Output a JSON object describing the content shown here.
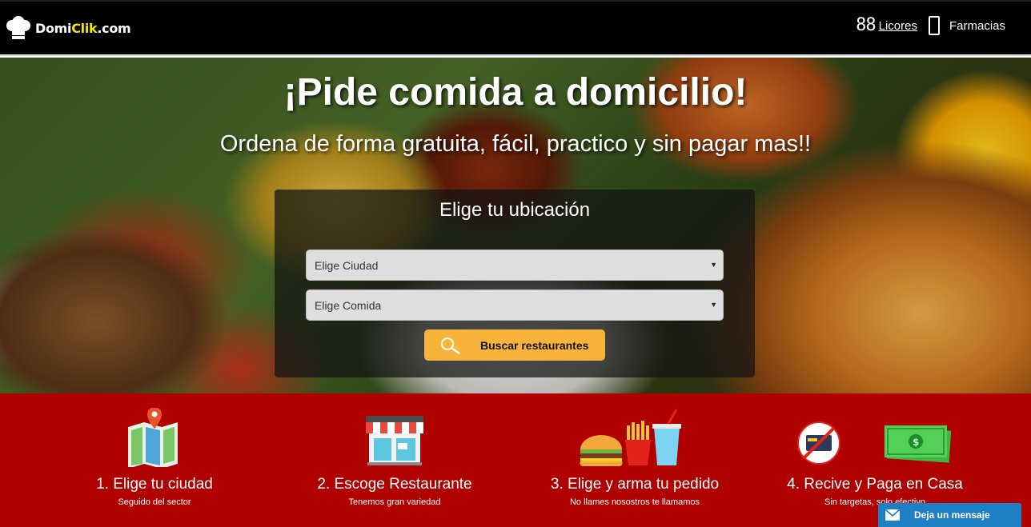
{
  "header": {
    "logo": {
      "text_main": "Domi",
      "text_highlight": "Clik",
      "text_suffix": ".com",
      "icon": "chef-hat-icon"
    },
    "nav": [
      {
        "icon": "88",
        "label": "Licores"
      },
      {
        "icon": "mobile-phone-icon",
        "label": "Farmacias"
      }
    ]
  },
  "hero": {
    "title": "¡Pide comida a domicilio!",
    "subtitle": "Ordena de forma gratuita, fácil, practico y sin pagar mas!!",
    "panel_title": "Elige tu ubicación",
    "city_select": {
      "value": "Elige Ciudad"
    },
    "food_select": {
      "value": "Elige Comida"
    },
    "search_button": "Buscar restaurantes"
  },
  "steps": [
    {
      "title": "1. Elige tu ciudad",
      "desc": "Seguido del sector",
      "icon": "map-pin-icon"
    },
    {
      "title": "2. Escoge Restaurante",
      "desc": "Tenemos gran variedad",
      "icon": "storefront-icon"
    },
    {
      "title": "3. Elige y arma tu pedido",
      "desc": "No llames nosostros te llamamos",
      "icon": "fast-food-icon"
    },
    {
      "title": "4. Recive y Paga en Casa",
      "desc": "Sin targetas, solo efectivo",
      "icon": "cash-icon"
    }
  ],
  "chat": {
    "label": "Deja un mensaje",
    "icon": "envelope-icon"
  },
  "colors": {
    "header_bg": "#000000",
    "steps_bg": "#b00000",
    "button": "#f8b33a",
    "chat": "#1d7fc4",
    "logo_highlight": "#f5e400"
  }
}
